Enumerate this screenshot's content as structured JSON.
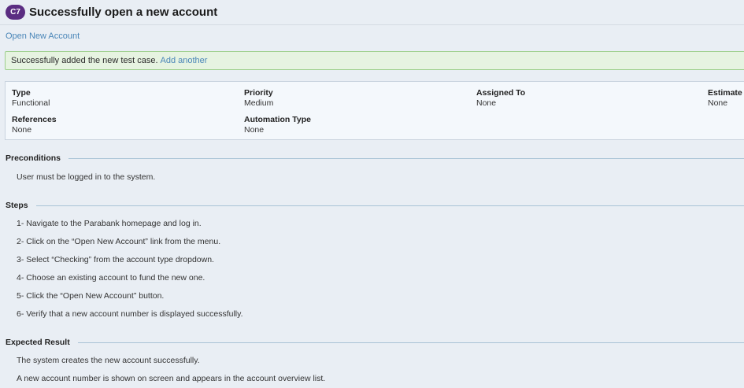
{
  "header": {
    "case_id": "C7",
    "title": "Successfully open a new account"
  },
  "breadcrumb": "Open New Account",
  "banner": {
    "message": "Successfully added the new test case.",
    "link": "Add another"
  },
  "properties": {
    "type_label": "Type",
    "type_value": "Functional",
    "priority_label": "Priority",
    "priority_value": "Medium",
    "assigned_label": "Assigned To",
    "assigned_value": "None",
    "estimate_label": "Estimate",
    "estimate_value": "None",
    "references_label": "References",
    "references_value": "None",
    "automation_label": "Automation Type",
    "automation_value": "None"
  },
  "preconditions": {
    "title": "Preconditions",
    "lines": [
      "User must be logged in to the system."
    ]
  },
  "steps": {
    "title": "Steps",
    "lines": [
      "1- Navigate to the Parabank homepage and log in.",
      "2- Click on the “Open New Account” link from the menu.",
      "3- Select “Checking” from the account type dropdown.",
      "4- Choose an existing account to fund the new one.",
      "5- Click the “Open New Account” button.",
      "6- Verify that a new account number is displayed successfully."
    ]
  },
  "expected": {
    "title": "Expected Result",
    "lines": [
      "The system creates the new account successfully.",
      "A new account number is shown on screen and appears in the account overview list."
    ]
  },
  "colors": {
    "badge": "#5b2d82",
    "link": "#4a86b8",
    "success_bg": "#e6f3e1",
    "success_border": "#9dcf8c",
    "rule": "#a9c3d6"
  }
}
